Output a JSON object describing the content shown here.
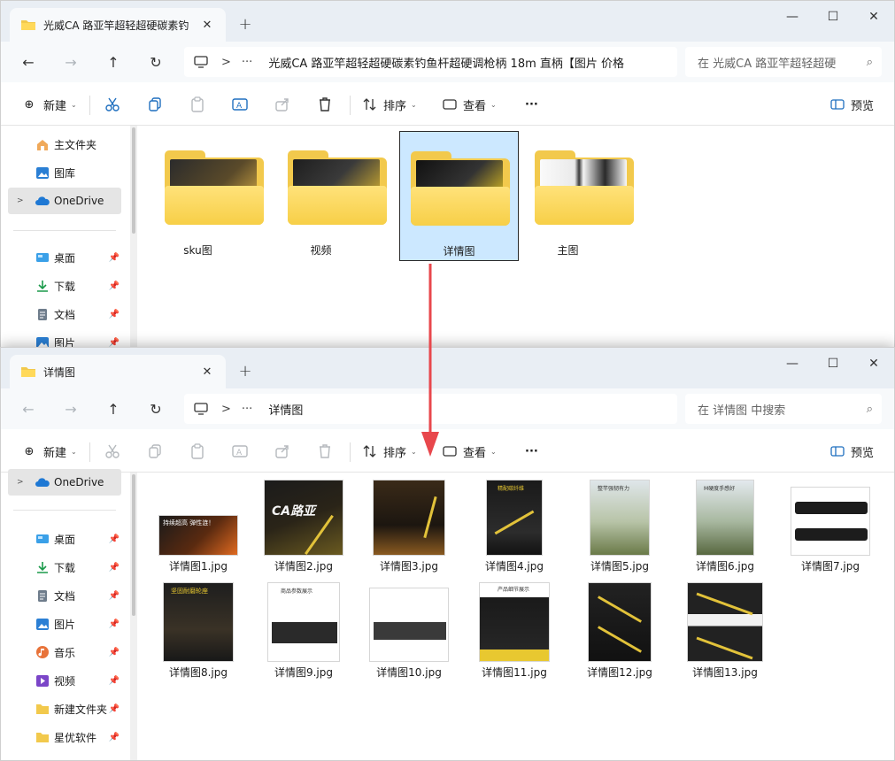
{
  "colors": {
    "accent": "#0067c0",
    "folder": "#f2c94c",
    "selection": "#cce8ff",
    "arrow": "#e8474c"
  },
  "icons": {
    "close": "✕",
    "plus": "+",
    "minimize": "—",
    "maximize": "☐",
    "back": "←",
    "forward": "→",
    "up": "↑",
    "refresh": "↻",
    "chevron_right": ">",
    "ellipsis": "···",
    "search": "⌕",
    "new": "⊕",
    "chevron_down": "⌄",
    "pin": "📌",
    "expand": ">"
  },
  "window1": {
    "tab_title": "光威CA 路亚竿超轻超硬碳素钓",
    "address_path": "光威CA 路亚竿超轻超硬碳素钓鱼杆超硬调枪柄 18m 直柄【图片 价格",
    "search_placeholder": "在 光威CA 路亚竿超轻超硬",
    "toolbar": {
      "new": "新建",
      "sort": "排序",
      "view": "查看",
      "more": "···",
      "preview": "预览"
    },
    "sidebar": [
      {
        "label": "主文件夹",
        "icon": "home-icon"
      },
      {
        "label": "图库",
        "icon": "gallery-icon"
      },
      {
        "label": "OneDrive",
        "icon": "onedrive-icon"
      },
      {
        "label": "桌面",
        "icon": "desktop-icon"
      },
      {
        "label": "下载",
        "icon": "download-icon"
      },
      {
        "label": "文档",
        "icon": "document-icon"
      },
      {
        "label": "图片",
        "icon": "pictures-icon"
      }
    ],
    "folders": [
      {
        "name": "sku图"
      },
      {
        "name": "视频"
      },
      {
        "name": "详情图"
      },
      {
        "name": "主图"
      }
    ]
  },
  "window2": {
    "tab_title": "详情图",
    "address_path": "详情图",
    "search_placeholder": "在 详情图 中搜索",
    "toolbar": {
      "new": "新建",
      "sort": "排序",
      "view": "查看",
      "more": "···",
      "preview": "预览"
    },
    "sidebar": [
      {
        "label": "OneDrive",
        "icon": "onedrive-icon"
      },
      {
        "label": "桌面",
        "icon": "desktop-icon"
      },
      {
        "label": "下载",
        "icon": "download-icon"
      },
      {
        "label": "文档",
        "icon": "document-icon"
      },
      {
        "label": "图片",
        "icon": "pictures-icon"
      },
      {
        "label": "音乐",
        "icon": "music-icon"
      },
      {
        "label": "视频",
        "icon": "video-icon"
      },
      {
        "label": "新建文件夹",
        "icon": "folder-icon"
      },
      {
        "label": "星优软件",
        "icon": "folder-icon"
      }
    ],
    "files": [
      {
        "name": "详情图1.jpg",
        "thumb_text": "持续超高 弹性涟！"
      },
      {
        "name": "详情图2.jpg",
        "thumb_text": "CA路亚"
      },
      {
        "name": "详情图3.jpg",
        "thumb_text": ""
      },
      {
        "name": "详情图4.jpg",
        "thumb_text": "精配碳纤维"
      },
      {
        "name": "详情图5.jpg",
        "thumb_text": "整竿强韧有力"
      },
      {
        "name": "详情图6.jpg",
        "thumb_text": "M硬度手感好"
      },
      {
        "name": "详情图7.jpg",
        "thumb_text": ""
      },
      {
        "name": "详情图8.jpg",
        "thumb_text": "坚固耐磨轮座"
      },
      {
        "name": "详情图9.jpg",
        "thumb_text": "商品参数展示"
      },
      {
        "name": "详情图10.jpg",
        "thumb_text": ""
      },
      {
        "name": "详情图11.jpg",
        "thumb_text": "产品细节展示"
      },
      {
        "name": "详情图12.jpg",
        "thumb_text": ""
      },
      {
        "name": "详情图13.jpg",
        "thumb_text": ""
      }
    ]
  }
}
